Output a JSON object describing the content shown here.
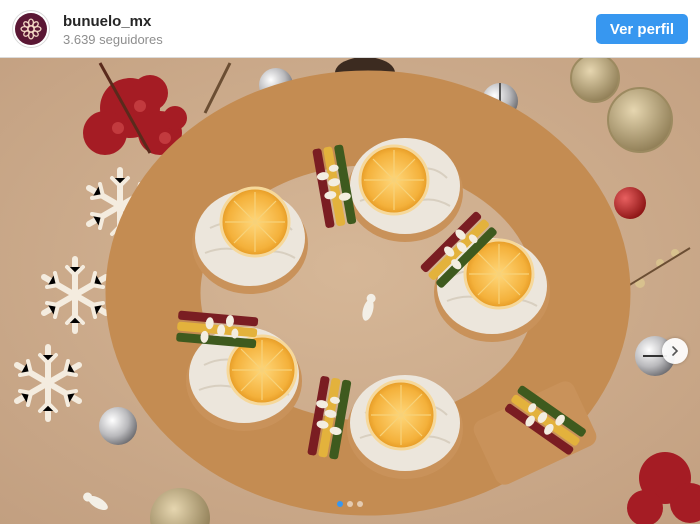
{
  "post_header": {
    "username": "bunuelo_mx",
    "followers": "3.639 seguidores",
    "follow_button": "Ver perfil"
  },
  "photo": {
    "subject": "rosca-de-reyes",
    "carousel": {
      "total": 3,
      "current": 1
    }
  },
  "colors": {
    "accent": "#3797f0",
    "avatar_bg": "#5b1734"
  },
  "icons": {
    "avatar_logo": "flower-logo-icon",
    "next": "chevron-right-icon"
  }
}
